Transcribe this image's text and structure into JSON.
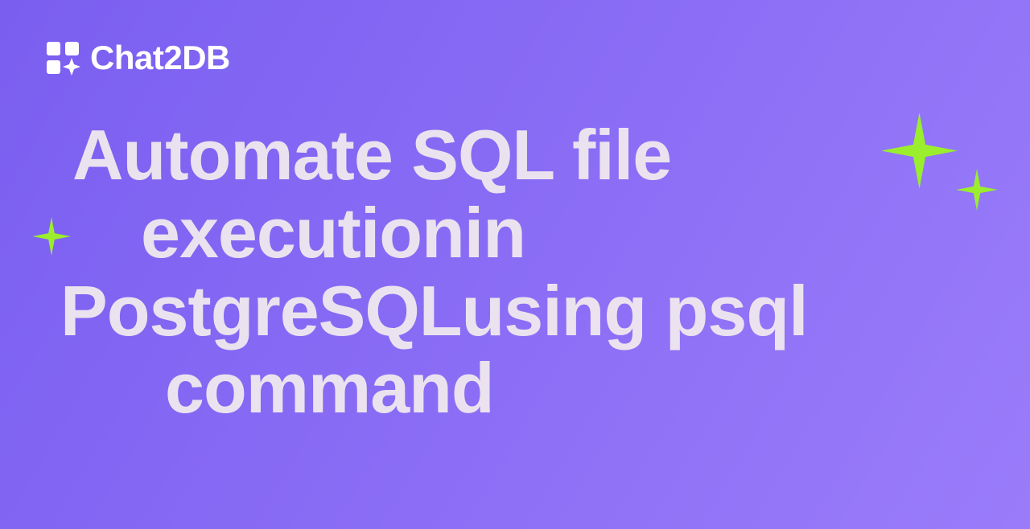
{
  "brand": {
    "name": "Chat2DB"
  },
  "title": {
    "line1": "Automate SQL file",
    "line2": "executionin",
    "line3": "PostgreSQLusing psql",
    "line4": "command"
  },
  "colors": {
    "background_start": "#7a5ef0",
    "background_end": "#9a7cfa",
    "text": "#eae3ef",
    "brand_text": "#ffffff",
    "accent": "#9aee2e"
  }
}
